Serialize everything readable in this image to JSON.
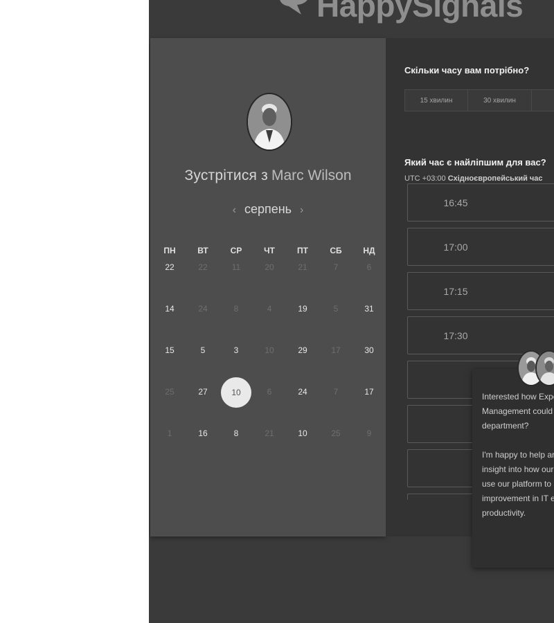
{
  "brand": {
    "name": "HappySignals"
  },
  "booking": {
    "title_prefix": "Зустрітися з",
    "host_name": "Marc Wilson",
    "month": "серпень",
    "prev_arrow": "‹",
    "next_arrow": "›"
  },
  "calendar": {
    "weekdays": [
      "ПН",
      "ВТ",
      "СР",
      "ЧТ",
      "ПТ",
      "СБ",
      "НД"
    ],
    "selected_day": "10",
    "weeks": [
      [
        {
          "d": "22",
          "on": true
        },
        {
          "d": "22",
          "on": false
        },
        {
          "d": "11",
          "on": false
        },
        {
          "d": "20",
          "on": false
        },
        {
          "d": "21",
          "on": false
        },
        {
          "d": "7",
          "on": false
        },
        {
          "d": "6",
          "on": false
        }
      ],
      [
        {
          "d": "14",
          "on": true
        },
        {
          "d": "24",
          "on": false
        },
        {
          "d": "8",
          "on": false
        },
        {
          "d": "4",
          "on": false
        },
        {
          "d": "19",
          "on": true
        },
        {
          "d": "5",
          "on": false
        },
        {
          "d": "31",
          "on": true
        }
      ],
      [
        {
          "d": "15",
          "on": true
        },
        {
          "d": "5",
          "on": true
        },
        {
          "d": "3",
          "on": true
        },
        {
          "d": "10",
          "on": false
        },
        {
          "d": "29",
          "on": true
        },
        {
          "d": "17",
          "on": false
        },
        {
          "d": "30",
          "on": true
        }
      ],
      [
        {
          "d": "25",
          "on": false
        },
        {
          "d": "27",
          "on": true
        },
        {
          "d": "10",
          "on": true,
          "selected": true
        },
        {
          "d": "6",
          "on": false
        },
        {
          "d": "24",
          "on": true
        },
        {
          "d": "7",
          "on": false
        },
        {
          "d": "17",
          "on": true
        }
      ],
      [
        {
          "d": "1",
          "on": false
        },
        {
          "d": "16",
          "on": true
        },
        {
          "d": "8",
          "on": true
        },
        {
          "d": "21",
          "on": false
        },
        {
          "d": "10",
          "on": true
        },
        {
          "d": "25",
          "on": false
        },
        {
          "d": "9",
          "on": false
        }
      ]
    ]
  },
  "scheduler": {
    "duration_question": "Скільки часу вам потрібно?",
    "durations": [
      "15 хвилин",
      "30 хвилин",
      ""
    ],
    "time_question": "Який час є найліпшим для вас?",
    "timezone_offset": "UTC +03:00",
    "timezone_name": "Східноєвропейський час",
    "slots": [
      "16:45",
      "17:00",
      "17:15",
      "17:30",
      "",
      "",
      "",
      ""
    ]
  },
  "chat": {
    "message": "Interested how Expe\nManagement could\ndepartment?\n\nI'm happy to help ar\ninsight into how our\nuse our platform to a\nimprovement in IT e\nproductivity."
  },
  "colors": {
    "page_bg": "#3a3a3a",
    "calendar_panel": "#4d4d4d",
    "slots_panel": "#333333",
    "selected_day": "#e9e9e9"
  }
}
